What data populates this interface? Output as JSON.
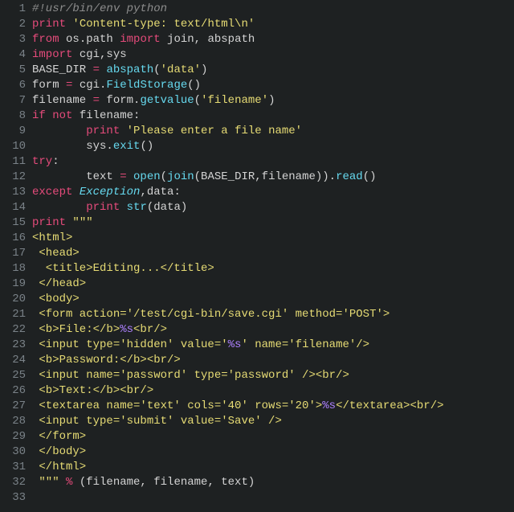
{
  "lines": {
    "1": [
      {
        "t": "#!usr/bin/env python",
        "c": "c-comment"
      }
    ],
    "2": [
      {
        "t": "print",
        "c": "c-kw"
      },
      {
        "t": " ",
        "c": "c-punct"
      },
      {
        "t": "'Content-type: text/html\\n'",
        "c": "c-str"
      }
    ],
    "3": [
      {
        "t": "from",
        "c": "c-kw"
      },
      {
        "t": " os.path ",
        "c": "c-var"
      },
      {
        "t": "import",
        "c": "c-kw"
      },
      {
        "t": " join, abspath",
        "c": "c-var"
      }
    ],
    "4": [
      {
        "t": "import",
        "c": "c-kw"
      },
      {
        "t": " cgi,sys",
        "c": "c-var"
      }
    ],
    "5": [
      {
        "t": "BASE_DIR ",
        "c": "c-var"
      },
      {
        "t": "=",
        "c": "c-kw"
      },
      {
        "t": " ",
        "c": "c-punct"
      },
      {
        "t": "abspath",
        "c": "c-func"
      },
      {
        "t": "(",
        "c": "c-punct"
      },
      {
        "t": "'data'",
        "c": "c-str"
      },
      {
        "t": ")",
        "c": "c-punct"
      }
    ],
    "6": [
      {
        "t": "form ",
        "c": "c-var"
      },
      {
        "t": "=",
        "c": "c-kw"
      },
      {
        "t": " cgi.",
        "c": "c-var"
      },
      {
        "t": "FieldStorage",
        "c": "c-func"
      },
      {
        "t": "()",
        "c": "c-punct"
      }
    ],
    "7": [
      {
        "t": "filename ",
        "c": "c-var"
      },
      {
        "t": "=",
        "c": "c-kw"
      },
      {
        "t": " form.",
        "c": "c-var"
      },
      {
        "t": "getvalue",
        "c": "c-func"
      },
      {
        "t": "(",
        "c": "c-punct"
      },
      {
        "t": "'filename'",
        "c": "c-str"
      },
      {
        "t": ")",
        "c": "c-punct"
      }
    ],
    "8": [
      {
        "t": "if",
        "c": "c-kw"
      },
      {
        "t": " ",
        "c": "c-punct"
      },
      {
        "t": "not",
        "c": "c-kw"
      },
      {
        "t": " filename:",
        "c": "c-var"
      }
    ],
    "9": [
      {
        "t": "        ",
        "c": "c-punct"
      },
      {
        "t": "print",
        "c": "c-kw"
      },
      {
        "t": " ",
        "c": "c-punct"
      },
      {
        "t": "'Please enter a file name'",
        "c": "c-str"
      }
    ],
    "10": [
      {
        "t": "        sys.",
        "c": "c-var"
      },
      {
        "t": "exit",
        "c": "c-func"
      },
      {
        "t": "()",
        "c": "c-punct"
      }
    ],
    "11": [
      {
        "t": "try",
        "c": "c-kw"
      },
      {
        "t": ":",
        "c": "c-var"
      }
    ],
    "12": [
      {
        "t": "        text ",
        "c": "c-var"
      },
      {
        "t": "=",
        "c": "c-kw"
      },
      {
        "t": " ",
        "c": "c-punct"
      },
      {
        "t": "open",
        "c": "c-func"
      },
      {
        "t": "(",
        "c": "c-punct"
      },
      {
        "t": "join",
        "c": "c-func"
      },
      {
        "t": "(BASE_DIR,filename)).",
        "c": "c-var"
      },
      {
        "t": "read",
        "c": "c-func"
      },
      {
        "t": "()",
        "c": "c-punct"
      }
    ],
    "13": [
      {
        "t": "except",
        "c": "c-kw"
      },
      {
        "t": " ",
        "c": "c-punct"
      },
      {
        "t": "Exception",
        "c": "c-class"
      },
      {
        "t": ",data:",
        "c": "c-var"
      }
    ],
    "14": [
      {
        "t": "        ",
        "c": "c-punct"
      },
      {
        "t": "print",
        "c": "c-kw"
      },
      {
        "t": " ",
        "c": "c-punct"
      },
      {
        "t": "str",
        "c": "c-func"
      },
      {
        "t": "(data)",
        "c": "c-var"
      }
    ],
    "15": [
      {
        "t": "print",
        "c": "c-kw"
      },
      {
        "t": " ",
        "c": "c-punct"
      },
      {
        "t": "\"\"\"",
        "c": "c-str"
      }
    ],
    "16": [
      {
        "t": "<html>",
        "c": "c-str"
      }
    ],
    "17": [
      {
        "t": " <head>",
        "c": "c-str"
      }
    ],
    "18": [
      {
        "t": "  <title>Editing...</title>",
        "c": "c-str"
      }
    ],
    "19": [
      {
        "t": " </head>",
        "c": "c-str"
      }
    ],
    "20": [
      {
        "t": " <body>",
        "c": "c-str"
      }
    ],
    "21": [
      {
        "t": " <form action='/test/cgi-bin/save.cgi' method='POST'>",
        "c": "c-str"
      }
    ],
    "22": [
      {
        "t": " <b>File:</b>",
        "c": "c-str"
      },
      {
        "t": "%s",
        "c": "c-fmt"
      },
      {
        "t": "<br/>",
        "c": "c-str"
      }
    ],
    "23": [
      {
        "t": " <input type='hidden' value='",
        "c": "c-str"
      },
      {
        "t": "%s",
        "c": "c-fmt"
      },
      {
        "t": "' name='filename'/>",
        "c": "c-str"
      }
    ],
    "24": [
      {
        "t": " <b>Password:</b><br/>",
        "c": "c-str"
      }
    ],
    "25": [
      {
        "t": " <input name='password' type='password' /><br/>",
        "c": "c-str"
      }
    ],
    "26": [
      {
        "t": " <b>Text:</b><br/>",
        "c": "c-str"
      }
    ],
    "27": [
      {
        "t": " <textarea name='text' cols='40' rows='20'>",
        "c": "c-str"
      },
      {
        "t": "%s",
        "c": "c-fmt"
      },
      {
        "t": "</textarea><br/>",
        "c": "c-str"
      }
    ],
    "28": [
      {
        "t": " <input type='submit' value='Save' />",
        "c": "c-str"
      }
    ],
    "29": [
      {
        "t": " </form>",
        "c": "c-str"
      }
    ],
    "30": [
      {
        "t": " </body>",
        "c": "c-str"
      }
    ],
    "31": [
      {
        "t": " </html>",
        "c": "c-str"
      }
    ],
    "32": [
      {
        "t": " \"\"\"",
        "c": "c-str"
      },
      {
        "t": " ",
        "c": "c-punct"
      },
      {
        "t": "%",
        "c": "c-op"
      },
      {
        "t": " (filename, filename, text)",
        "c": "c-var"
      }
    ],
    "33": [
      {
        "t": "",
        "c": "c-punct"
      }
    ]
  },
  "line_count": 33
}
